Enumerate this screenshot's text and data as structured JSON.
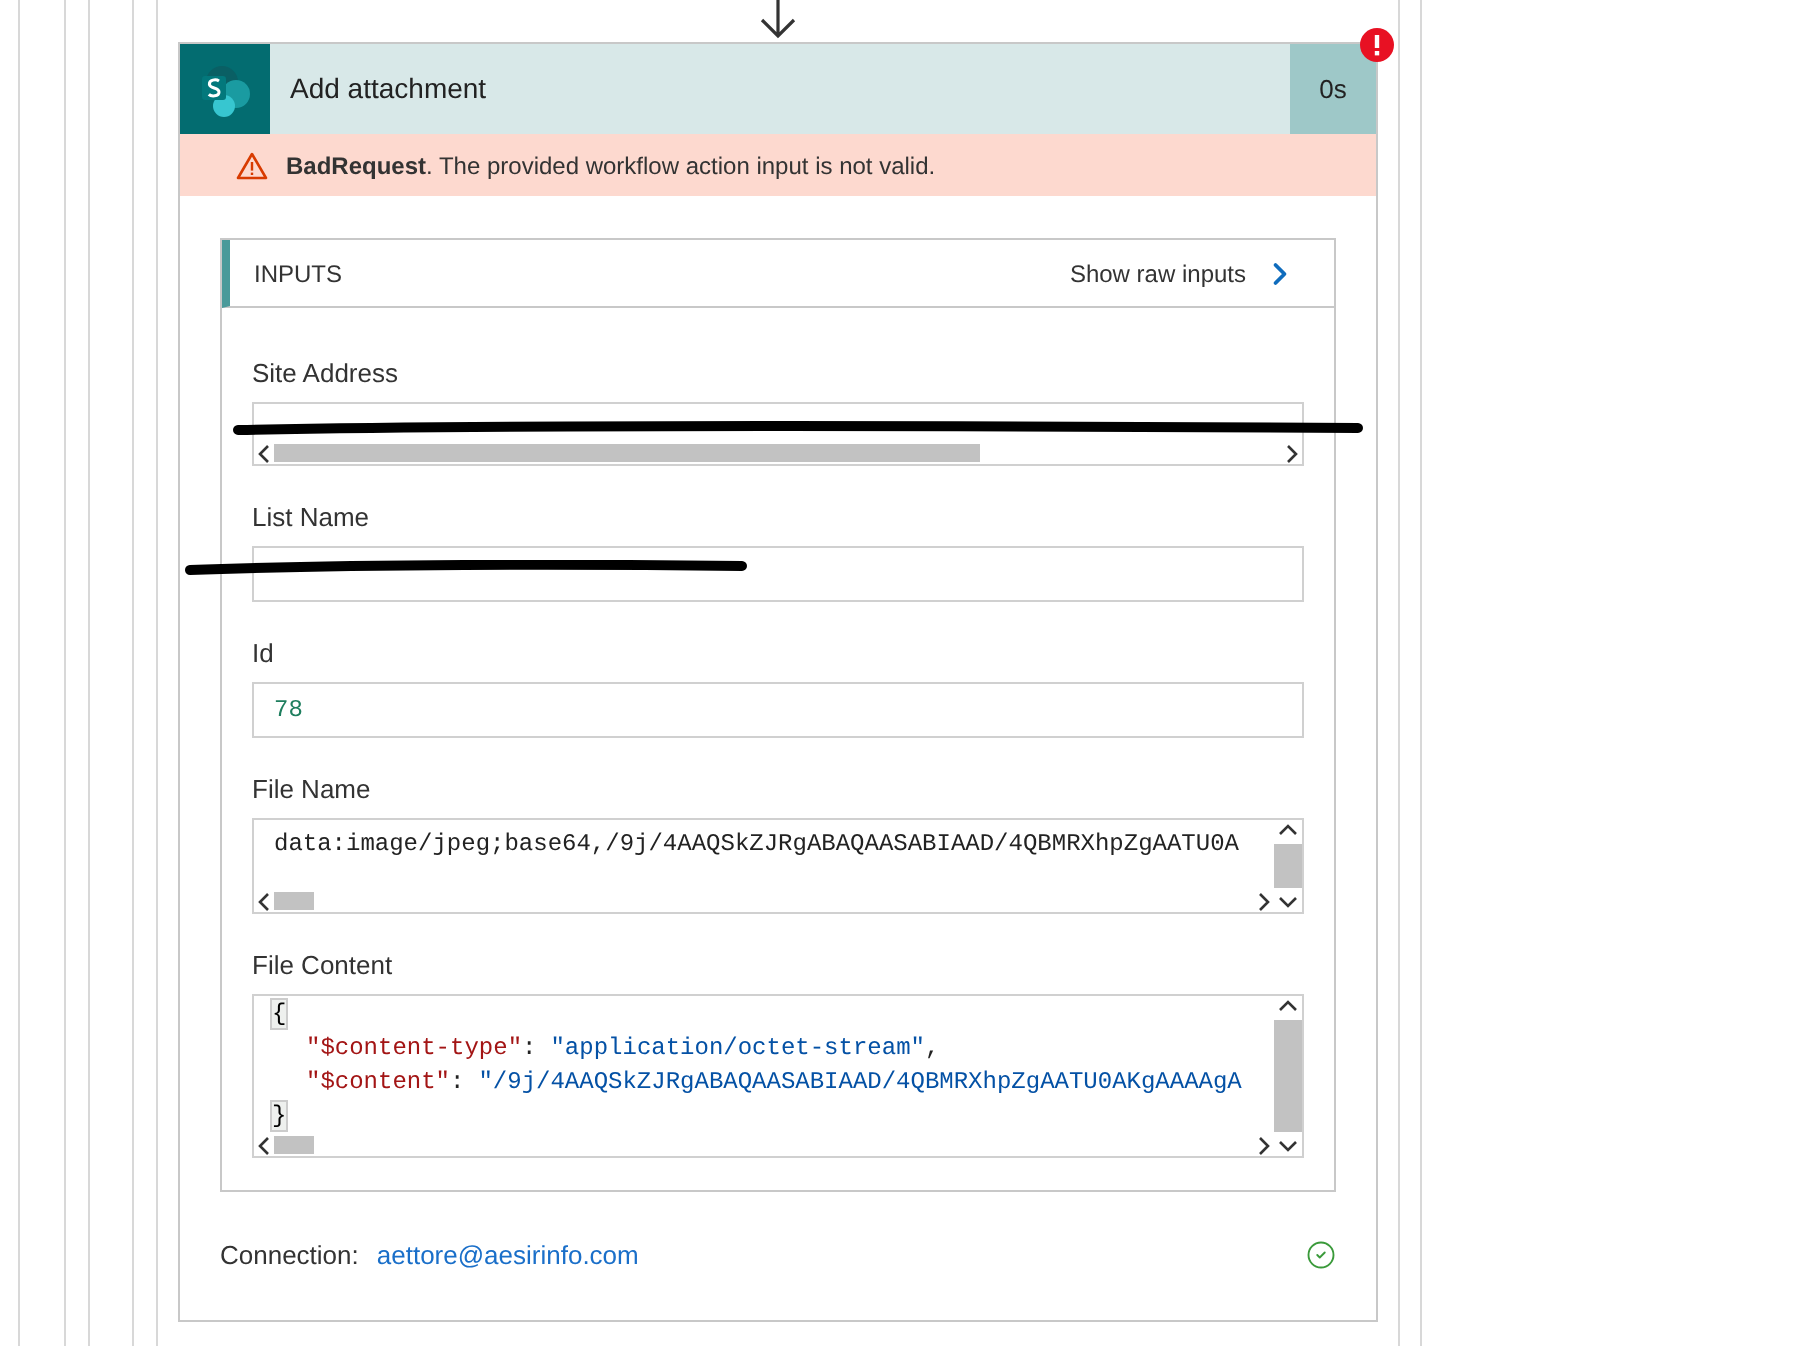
{
  "action": {
    "title": "Add attachment",
    "duration": "0s",
    "failed": true
  },
  "error": {
    "code": "BadRequest",
    "message": ". The provided workflow action input is not valid."
  },
  "inputs": {
    "title": "INPUTS",
    "raw_link": "Show raw inputs",
    "fields": [
      {
        "label": "Site Address",
        "kind": "redacted",
        "h_scroll": true,
        "v_scroll": false
      },
      {
        "label": "List Name",
        "kind": "redacted",
        "h_scroll": false,
        "v_scroll": false
      },
      {
        "label": "Id",
        "kind": "number",
        "value": "78",
        "h_scroll": false,
        "v_scroll": false
      },
      {
        "label": "File Name",
        "kind": "text",
        "value": "data:image/jpeg;base64,/9j/4AAQSkZJRgABAQAASABIAAD/4QBMRXhpZgAATU0A",
        "h_scroll": true,
        "v_scroll": true
      },
      {
        "label": "File Content",
        "kind": "json",
        "open": "{",
        "close": "}",
        "h_scroll": true,
        "v_scroll": true,
        "entries": [
          {
            "key": "\"$content-type\"",
            "sep": ":",
            "value": "\"application/octet-stream\"",
            "trail": ","
          },
          {
            "key": "\"$content\"",
            "sep": ":",
            "value": "\"/9j/4AAQSkZJRgABAQAASABIAAD/4QBMRXhpZgAATU0AKgAAAAgA"
          }
        ]
      }
    ]
  },
  "connection": {
    "label": "Connection:",
    "account": "aettore@aesirinfo.com",
    "ok": true
  }
}
